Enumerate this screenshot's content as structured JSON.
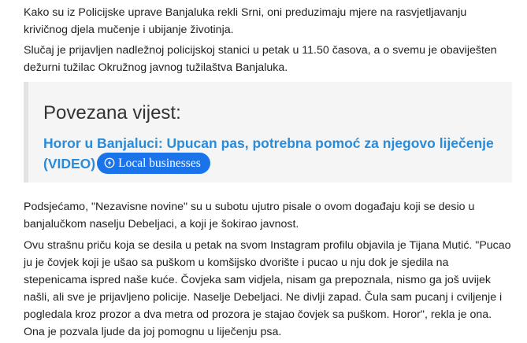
{
  "article": {
    "paragraphs": [
      "Kako su iz Policijske uprave Banjaluka rekli Srni, oni preduzimaju mjere na rasvjetljavanju krivičnog djela mučenje i ubijanje životinja.",
      "Slučaj je prijavljen nadležnoj policijskoj stanici u petak u 11.50 časova, a o svemu je obaviješten dežurni tužilac Okružnog javnog tužilaštva Banjaluka.",
      "Podsjećamo, \"Nezavisne novine\" su u subotu ujutro pisale o ovom događaju koji se desio u banjalučkom naselju Debeljaci, a koji je šokirao javnost.",
      "Ovu strašnu priču koja se desila u petak na svom Instagram profilu objavila je Tijana Mutić. \"Pucao ju je čovjek koji je ušao sa puškom u komšijsko dvorište i pucao u nju dok je sjedila na stepenicama ispred naše kuće. Čovjeka sam vidjela, nisam ga prepoznala, nismo ga još uvijek našli, ali sve je prijavljeno policije. Naselje Debeljaci. Ne divlji zapad. Čula sam pucanj i cviljenje i pogledala kroz prozor a dva metra od prozora je stajao čovjek sa puškom. Horor\", rekla je ona.",
      "Ona je pozvala ljude da joj pomognu u liječenju psa."
    ]
  },
  "related": {
    "heading": "Povezana vijest:",
    "link_text": "Horor u Banjaluci: Upucan pas, potrebna pomoć za njegovo liječenje (VIDEO)",
    "badge_label": "Local businesses",
    "badge_icon": "lightning-circle-icon"
  },
  "colors": {
    "link": "#2a8bd8",
    "badge_bg": "#1a73e8",
    "box_bg": "#f5f5f5",
    "box_border": "#e2e2e2",
    "text": "#222222"
  }
}
